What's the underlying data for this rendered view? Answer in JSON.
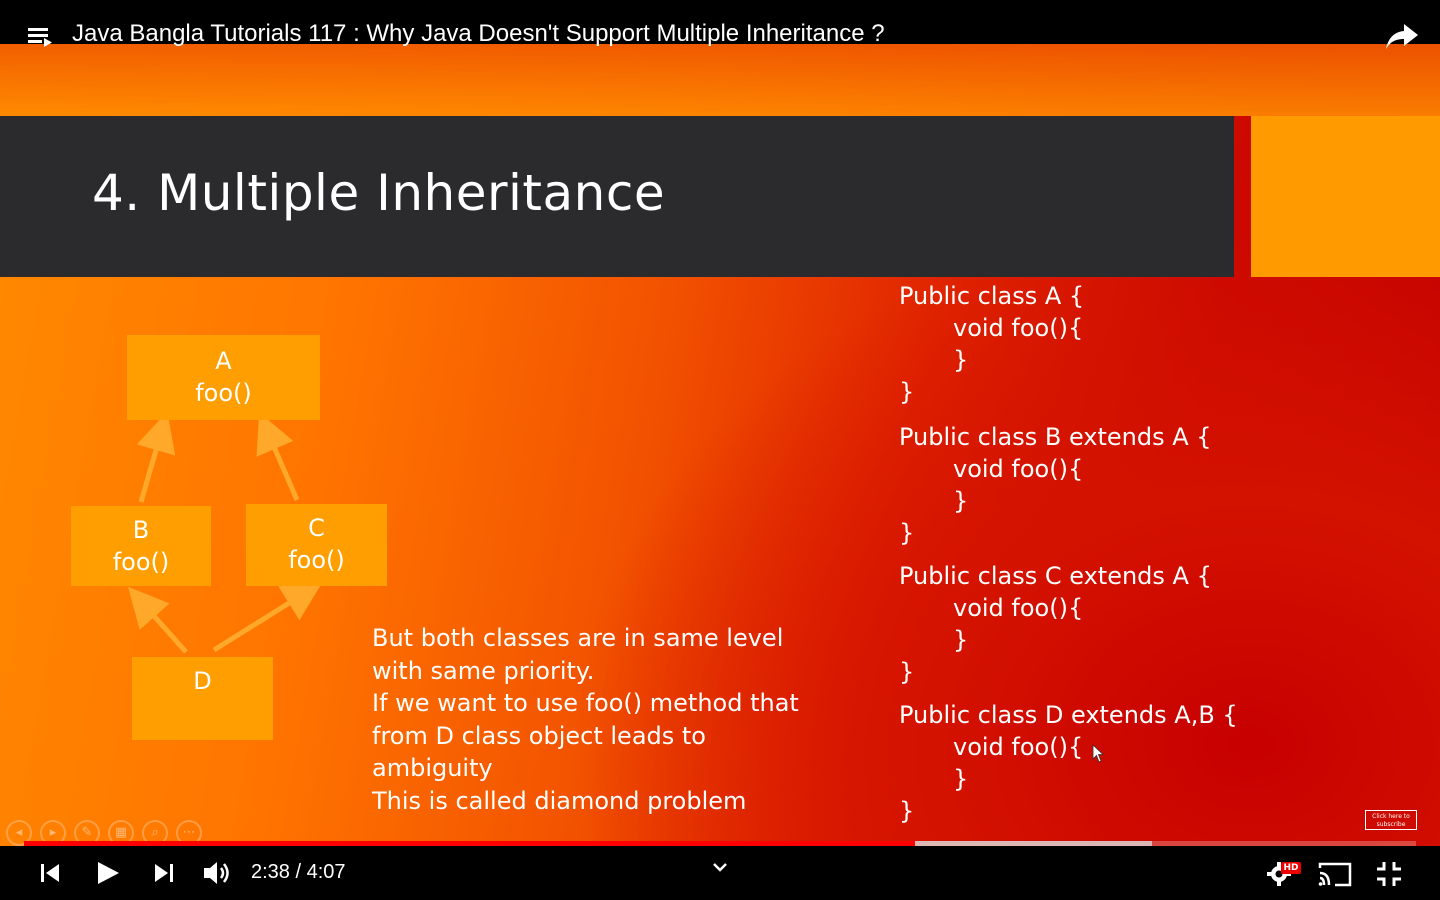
{
  "header": {
    "title": "Java Bangla Tutorials 117 : Why Java Doesn't Support Multiple Inheritance ?",
    "menu_icon": "playlist-menu-icon",
    "share_icon": "share-icon"
  },
  "slide": {
    "title": "4. Multiple Inheritance",
    "diagram": {
      "box_a": {
        "name": "A",
        "method": "foo()"
      },
      "box_b": {
        "name": "B",
        "method": "foo()"
      },
      "box_c": {
        "name": "C",
        "method": "foo()"
      },
      "box_d": {
        "name": "D"
      }
    },
    "explanation": [
      "But both classes are in same level",
      "with same priority.",
      "If we want to use foo() method that",
      "from D class object leads to",
      "ambiguity",
      "This is called diamond problem"
    ],
    "code": {
      "a_decl": "Public class A {",
      "a_method": "void foo(){",
      "a_method_close": "}",
      "a_close": "}",
      "b_decl": "Public class B extends A {",
      "b_method": "void foo(){",
      "b_method_close": "}",
      "b_close": "}",
      "c_decl": "Public class C extends A {",
      "c_method": "void foo(){",
      "c_method_close": "}",
      "c_close": "}",
      "d_decl": "Public class D extends A,B {",
      "d_method": "void foo(){",
      "d_method_close": "}",
      "d_close": "}"
    },
    "subscribe_badge": "Click here to subscribe",
    "colors": {
      "box": "#ff9e00",
      "title_band": "#2b2b2d",
      "accent_block": "#ff9a00"
    }
  },
  "player": {
    "current_time": "2:38",
    "separator": "/",
    "duration": "4:07",
    "time_display": "2:38 / 4:07",
    "played_fraction": 0.64,
    "buffered_fraction": 0.81,
    "progress_color": "#ff0000",
    "quality_badge": "HD",
    "icons": [
      "previous-icon",
      "play-icon",
      "next-icon",
      "volume-icon",
      "chevron-down-icon",
      "settings-icon",
      "cast-icon",
      "exit-fullscreen-icon"
    ]
  }
}
